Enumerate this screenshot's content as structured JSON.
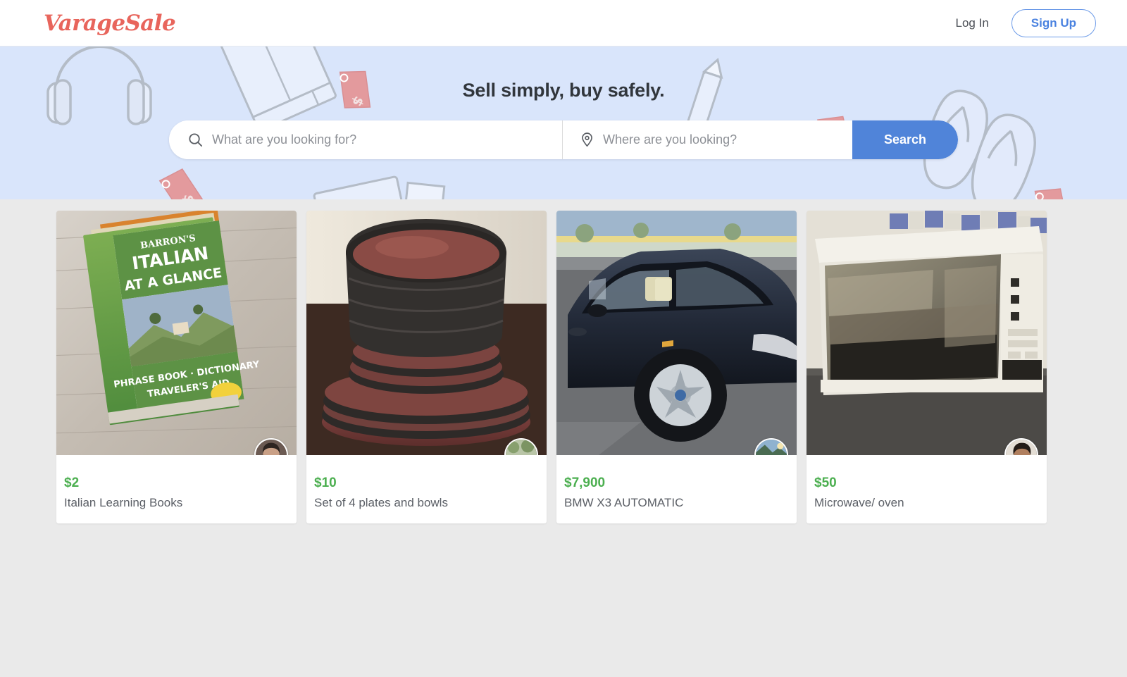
{
  "header": {
    "logo_text": "VarageSale",
    "login_label": "Log In",
    "signup_label": "Sign Up",
    "brand_color": "#e8655c",
    "accent_color": "#4a82e0"
  },
  "hero": {
    "tagline": "Sell simply, buy safely.",
    "background_color": "#d9e5fb",
    "search": {
      "query_placeholder": "What are you looking for?",
      "query_value": "",
      "query_icon": "search-icon",
      "location_placeholder": "Where are you looking?",
      "location_value": "",
      "location_icon": "location-pin-icon",
      "button_label": "Search",
      "button_color": "#5084d9"
    }
  },
  "main": {
    "background_color": "#eaeaea",
    "listings": [
      {
        "price": "$2",
        "title": "Italian Learning Books",
        "image_alt": "Barron's Italian At A Glance phrase book on weathered wood",
        "seller_avatar_alt": "seller portrait"
      },
      {
        "price": "$10",
        "title": "Set of 4 plates and bowls",
        "image_alt": "Stack of maroon and dark grey plates and bowls",
        "seller_avatar_alt": "seller outdoor photo"
      },
      {
        "price": "$7,900",
        "title": "BMW X3 AUTOMATIC",
        "image_alt": "Dark blue BMW X3 SUV parked in a lot",
        "seller_avatar_alt": "seller lake scene"
      },
      {
        "price": "$50",
        "title": "Microwave/ oven",
        "image_alt": "White countertop microwave oven",
        "seller_avatar_alt": "seller portrait"
      }
    ],
    "price_color": "#4caf50"
  }
}
